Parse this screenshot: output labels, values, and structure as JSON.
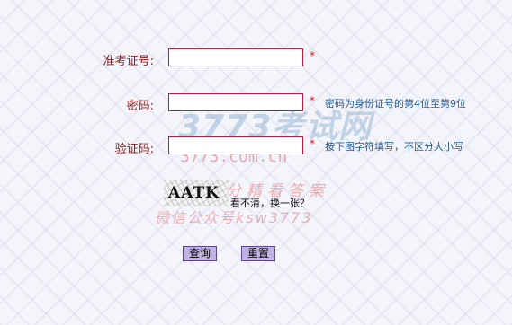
{
  "form": {
    "exam_no": {
      "label": "准考证号:",
      "value": "",
      "required_mark": "*"
    },
    "password": {
      "label": "密码:",
      "value": "",
      "required_mark": "*",
      "hint": "密码为身份证号的第4位至第9位"
    },
    "captcha": {
      "label": "验证码:",
      "value": "",
      "required_mark": "*",
      "hint": "按下图字符填写，不区分大小写"
    },
    "captcha_image_text": "AATK",
    "refresh_text": "看不清，换一张？"
  },
  "buttons": {
    "query": "查询",
    "reset": "重置"
  },
  "watermark": {
    "brand": "3773考试网",
    "url": "3773.com.cn",
    "line1": "查分精看答案",
    "line2": "微信公众号ksw3773"
  },
  "colors": {
    "label": "#8b1d1d",
    "required": "#d11c1c",
    "hint": "#1f5c96",
    "field_border": "#b01f3b",
    "button_bg": "#c2b2e3"
  }
}
